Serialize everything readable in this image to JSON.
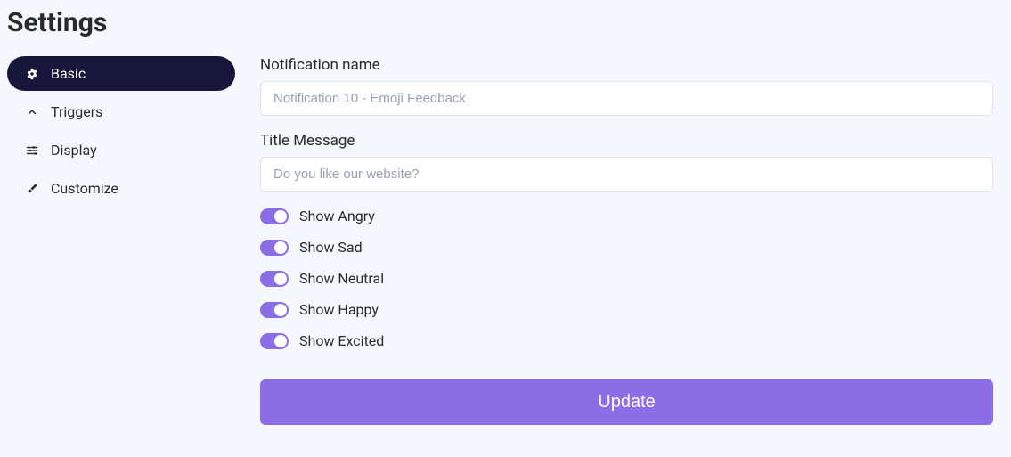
{
  "page_title": "Settings",
  "sidebar": {
    "items": [
      {
        "label": "Basic",
        "icon": "gear-icon",
        "active": true
      },
      {
        "label": "Triggers",
        "icon": "chevron-up-icon",
        "active": false
      },
      {
        "label": "Display",
        "icon": "sliders-icon",
        "active": false
      },
      {
        "label": "Customize",
        "icon": "brush-icon",
        "active": false
      }
    ]
  },
  "form": {
    "notification_label": "Notification name",
    "notification_value": "Notification 10 - Emoji Feedback",
    "title_label": "Title Message",
    "title_value": "Do you like our website?",
    "toggles": [
      {
        "label": "Show Angry",
        "on": true
      },
      {
        "label": "Show Sad",
        "on": true
      },
      {
        "label": "Show Neutral",
        "on": true
      },
      {
        "label": "Show Happy",
        "on": true
      },
      {
        "label": "Show Excited",
        "on": true
      }
    ],
    "submit_label": "Update"
  }
}
